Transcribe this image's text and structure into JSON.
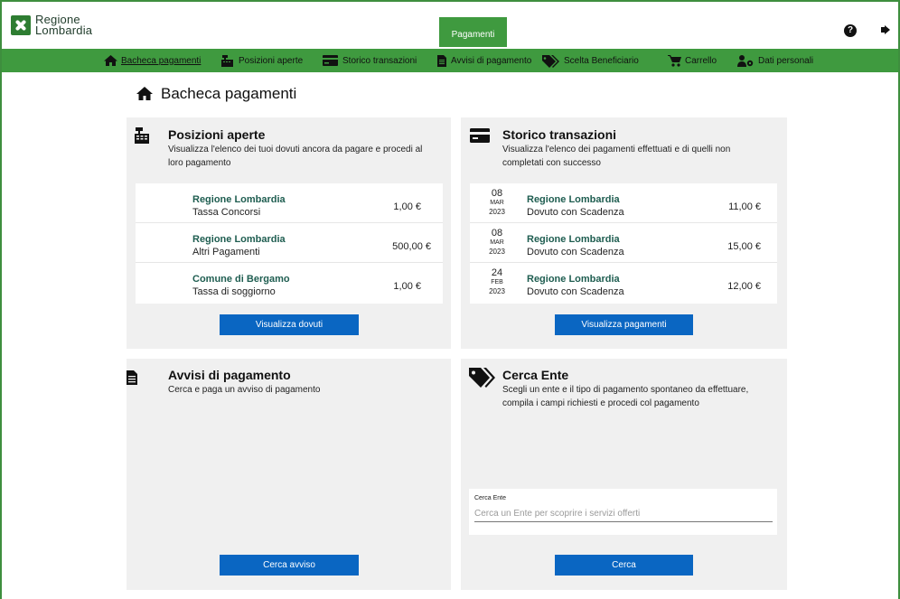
{
  "header": {
    "logo_line1": "Regione",
    "logo_line2": "Lombardia",
    "active_tab": "Pagamenti"
  },
  "nav": {
    "items": [
      {
        "label": "Bacheca pagamenti",
        "icon": "home-icon"
      },
      {
        "label": "Posizioni aperte",
        "icon": "cash-register-icon"
      },
      {
        "label": "Storico transazioni",
        "icon": "credit-card-icon"
      },
      {
        "label": "Avvisi di pagamento",
        "icon": "document-icon"
      },
      {
        "label": "Scelta Beneficiario",
        "icon": "tags-icon"
      },
      {
        "label": "Carrello",
        "icon": "cart-icon"
      },
      {
        "label": "Dati personali",
        "icon": "user-cog-icon"
      }
    ]
  },
  "page": {
    "title": "Bacheca pagamenti"
  },
  "posizioni": {
    "title": "Posizioni aperte",
    "desc_line1": "Visualizza l'elenco dei tuoi dovuti ancora da pagare e procedi al",
    "desc_line2": "loro pagamento",
    "rows": [
      {
        "ente": "Regione Lombardia",
        "desc": "Tassa Concorsi",
        "amount": "1,00 €"
      },
      {
        "ente": "Regione Lombardia",
        "desc": "Altri Pagamenti",
        "amount": "500,00 €"
      },
      {
        "ente": "Comune di Bergamo",
        "desc": "Tassa di soggiorno",
        "amount": "1,00 €"
      }
    ],
    "button": "Visualizza dovuti"
  },
  "storico": {
    "title": "Storico transazioni",
    "desc_line1": "Visualizza l'elenco dei pagamenti effettuati e di quelli non",
    "desc_line2": "completati con successo",
    "rows": [
      {
        "day": "08",
        "month": "MAR",
        "year": "2023",
        "ente": "Regione Lombardia",
        "desc": "Dovuto con Scadenza",
        "amount": "11,00 €"
      },
      {
        "day": "08",
        "month": "MAR",
        "year": "2023",
        "ente": "Regione Lombardia",
        "desc": "Dovuto con Scadenza",
        "amount": "15,00 €"
      },
      {
        "day": "24",
        "month": "FEB",
        "year": "2023",
        "ente": "Regione Lombardia",
        "desc": "Dovuto con Scadenza",
        "amount": "12,00 €"
      }
    ],
    "button": "Visualizza pagamenti"
  },
  "avvisi": {
    "title": "Avvisi di pagamento",
    "desc_line1": "Cerca e paga un avviso di pagamento",
    "button": "Cerca avviso"
  },
  "cerca_ente": {
    "title": "Cerca Ente",
    "desc_line1": "Scegli un ente e il tipo di pagamento spontaneo da effettuare,",
    "desc_line2": "compila i campi richiesti e procedi col pagamento",
    "field_label": "Cerca Ente",
    "placeholder": "Cerca un Ente per scoprire i servizi offerti",
    "value": "",
    "button": "Cerca"
  },
  "colors": {
    "brand_green": "#3f9a3f",
    "button_blue": "#0a66c2",
    "ente_teal": "#1e5d50"
  }
}
